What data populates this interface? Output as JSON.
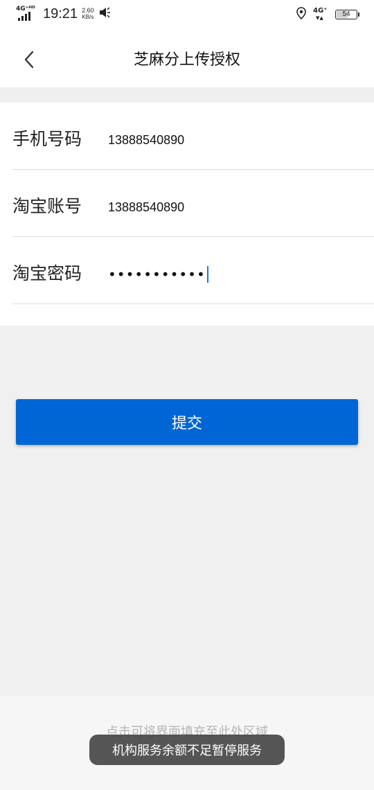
{
  "status_bar": {
    "network_left": "4G⁺ᴴᴰ",
    "time": "19:21",
    "speed_value": "2.60",
    "speed_unit": "KB/s",
    "network_right": "4G⁺",
    "network_arrows": "▼▲",
    "battery": "54",
    "battery_level_percent": 54,
    "icons": [
      "signal-icon",
      "mute-icon",
      "location-icon",
      "battery-icon"
    ]
  },
  "nav": {
    "title": "芝麻分上传授权",
    "back_icon": "chevron-left-icon"
  },
  "form": {
    "rows": [
      {
        "label": "手机号码",
        "value": "13888540890"
      },
      {
        "label": "淘宝账号",
        "value": "13888540890"
      },
      {
        "label": "淘宝密码",
        "value": "•••••••••••"
      }
    ]
  },
  "submit": {
    "label": "提交",
    "color": "#0066d6"
  },
  "bottom": {
    "hint": "点击可将界面填充至此处区域",
    "toast": "机构服务余额不足暂停服务"
  }
}
